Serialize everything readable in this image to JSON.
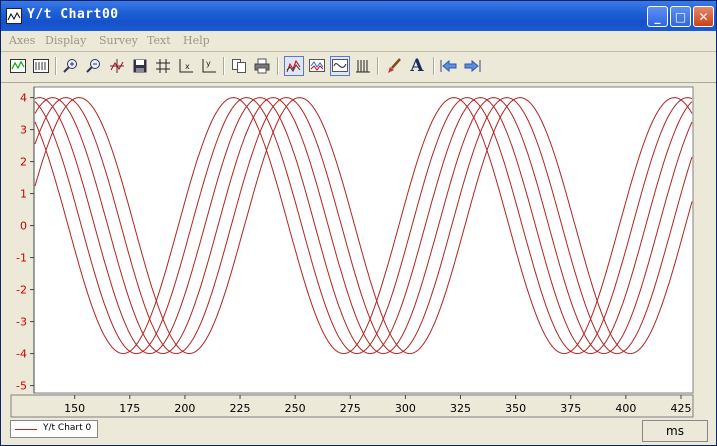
{
  "window": {
    "title": "Y/t Chart00"
  },
  "title_buttons": {
    "minimize": "_",
    "maximize": "□",
    "close": "✕"
  },
  "menu": [
    "Axes",
    "Display",
    "Survey",
    "Text",
    "Help"
  ],
  "toolbar": {
    "icons": [
      "chart-icon",
      "chart2-icon",
      "zoom-in-icon",
      "zoom-out-icon",
      "crosshair-icon",
      "save-icon",
      "grid-icon",
      "x-axis-icon",
      "y-axis-icon",
      "copy-icon",
      "print-icon",
      "style1-icon",
      "style2-icon",
      "style3-icon",
      "style4-icon",
      "brush-icon",
      "font-icon",
      "arrow-left-icon",
      "arrow-right-icon"
    ],
    "font_glyph": "A"
  },
  "legend": {
    "label": "Y/t Chart 0"
  },
  "units": {
    "label": "ms"
  },
  "colors": {
    "trace": "#b22222",
    "axis_label": "#cc0000",
    "title_blue": "#1d5fd6"
  },
  "chart_data": {
    "type": "line",
    "xlim": [
      132,
      430
    ],
    "ylim": [
      -5.2,
      4.3
    ],
    "yticks": [
      4,
      3,
      2,
      1,
      0,
      -1,
      -2,
      -3,
      -4,
      -5
    ],
    "xticks": [
      150,
      175,
      200,
      225,
      250,
      275,
      300,
      325,
      350,
      375,
      400,
      425
    ],
    "series": [
      {
        "amplitude": 4.0,
        "period": 100,
        "peak_at": 122,
        "segments": [
          [
            132,
            171
          ],
          [
            171,
            221
          ],
          [
            221,
            271
          ],
          [
            271,
            321
          ],
          [
            321,
            371
          ],
          [
            371,
            421
          ],
          [
            421,
            430
          ]
        ]
      }
    ],
    "sweep_offsets": [
      0,
      6,
      12,
      18,
      24,
      30
    ],
    "grid": false
  }
}
